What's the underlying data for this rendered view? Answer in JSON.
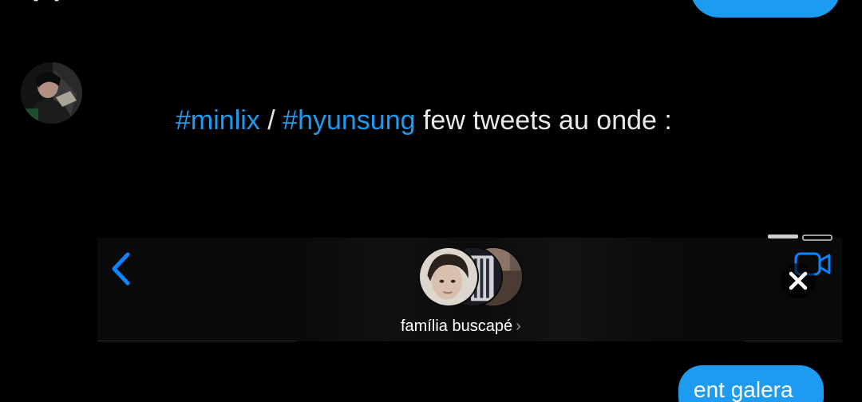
{
  "tweet": {
    "hashtag1": "#minlix",
    "separator": " / ",
    "hashtag2": "#hyunsung",
    "rest": " few tweets au onde :"
  },
  "embed": {
    "group_name": "família buscapé",
    "chevron": "›",
    "message": "ent galera"
  },
  "colors": {
    "accent": "#1d9bf0",
    "ios_blue": "#0a84ff",
    "background": "#000000"
  },
  "icons": {
    "back": "chevron-left-icon",
    "video": "video-camera-icon",
    "close": "close-icon"
  }
}
